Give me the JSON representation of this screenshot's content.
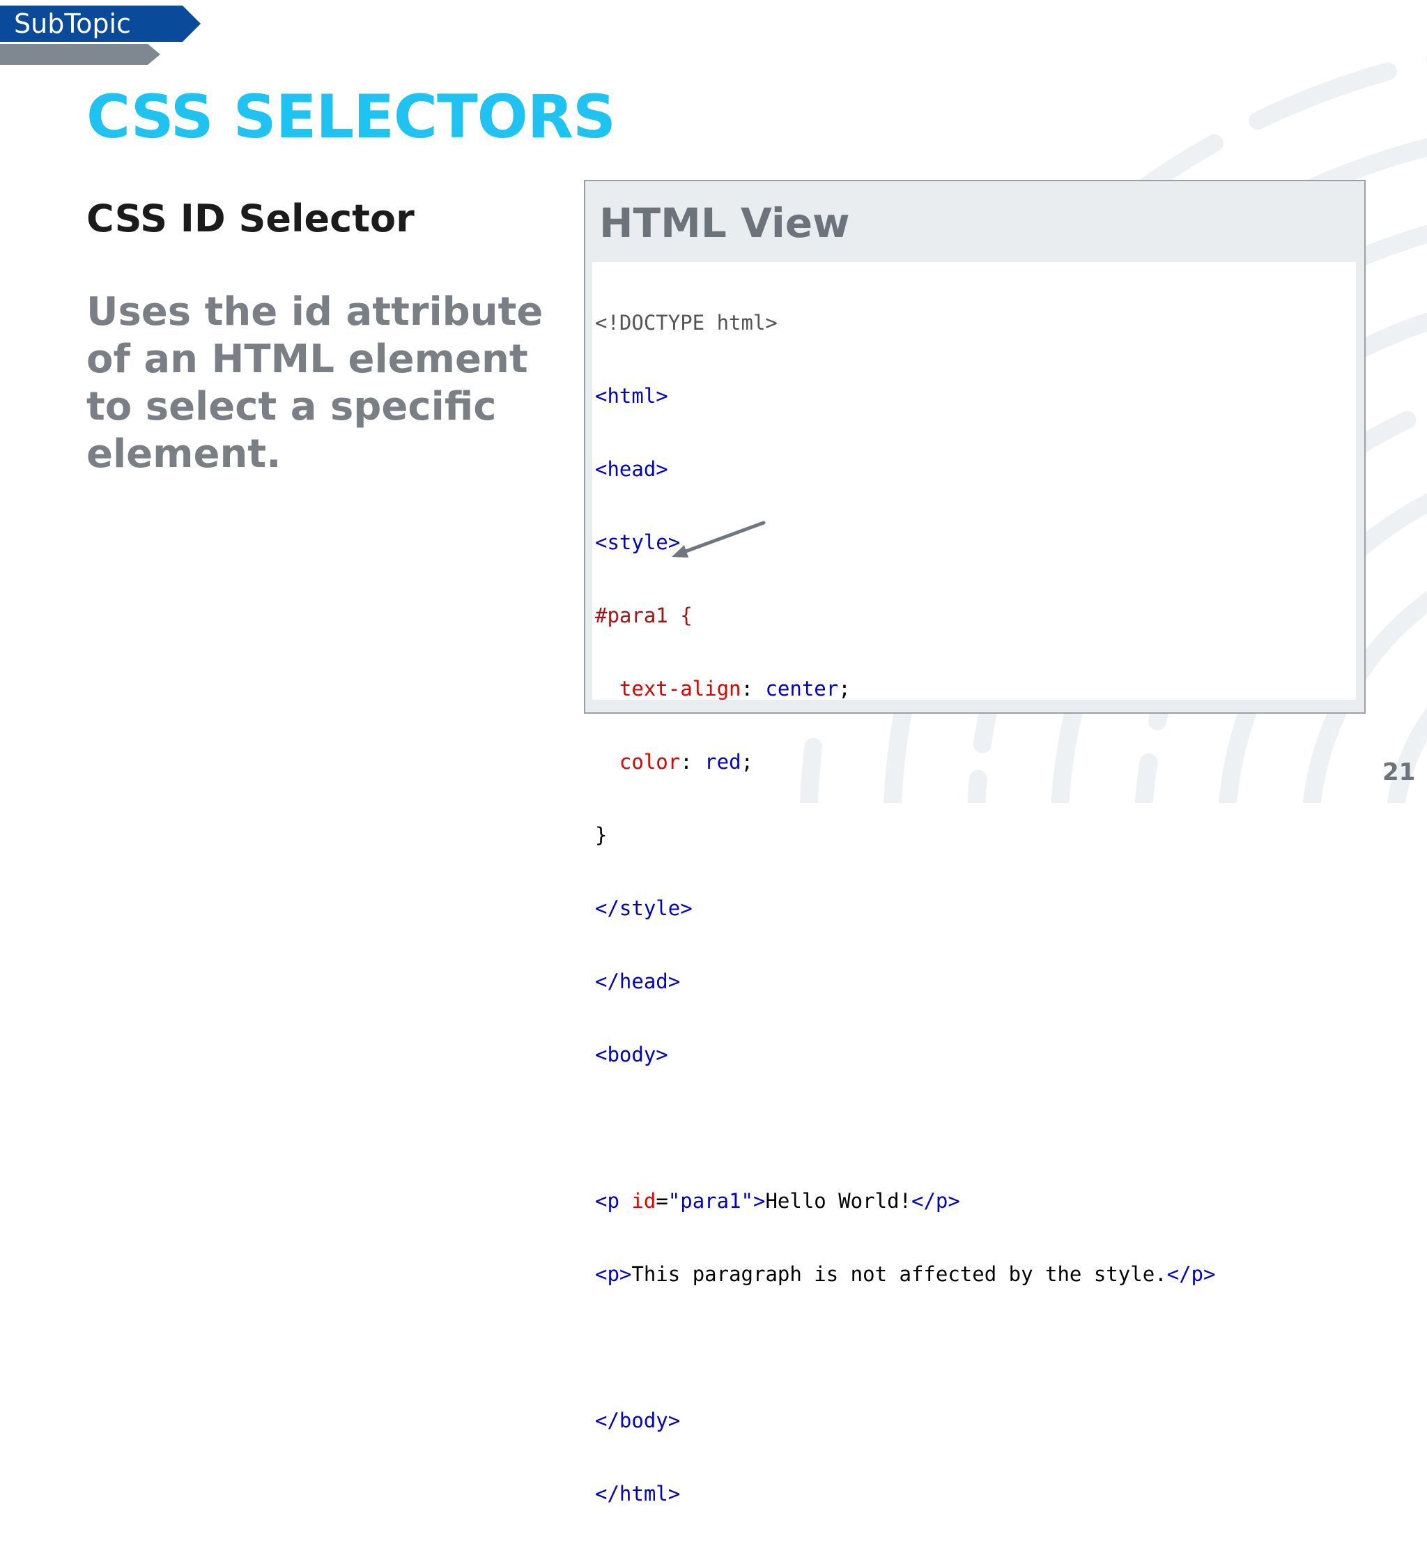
{
  "header": {
    "subtopic_label": "SubTopic",
    "title": "CSS SELECTORS"
  },
  "content": {
    "heading": "CSS ID Selector",
    "description": "Uses the id attribute of an HTML element to select a specific element."
  },
  "html_view": {
    "title": "HTML View",
    "code": {
      "doctype": "<!DOCTYPE html>",
      "html_open": "<html>",
      "head_open": "<head>",
      "style_open": "<style>",
      "selector": "#para1 {",
      "prop1_name": "text-align",
      "prop1_value": "center",
      "prop2_name": "color",
      "prop2_value": "red",
      "brace_close": "}",
      "style_close": "</style>",
      "head_close": "</head>",
      "body_open": "<body>",
      "p1_open_start": "<p ",
      "p1_attr_name": "id",
      "p1_attr_eq": "=",
      "p1_attr_value": "\"para1\"",
      "p1_open_end": ">",
      "p1_text": "Hello World!",
      "p1_close": "</p>",
      "p2_open": "<p>",
      "p2_text": "This paragraph is not affected by the style.",
      "p2_close": "</p>",
      "body_close": "</body>",
      "html_close": "</html>"
    }
  },
  "footer": {
    "page_number": "21"
  },
  "colors": {
    "title_accent": "#1ec3f1",
    "subtopic_tab": "#0a4a9a",
    "code_tag": "#0000cd",
    "code_property": "#e00000"
  }
}
